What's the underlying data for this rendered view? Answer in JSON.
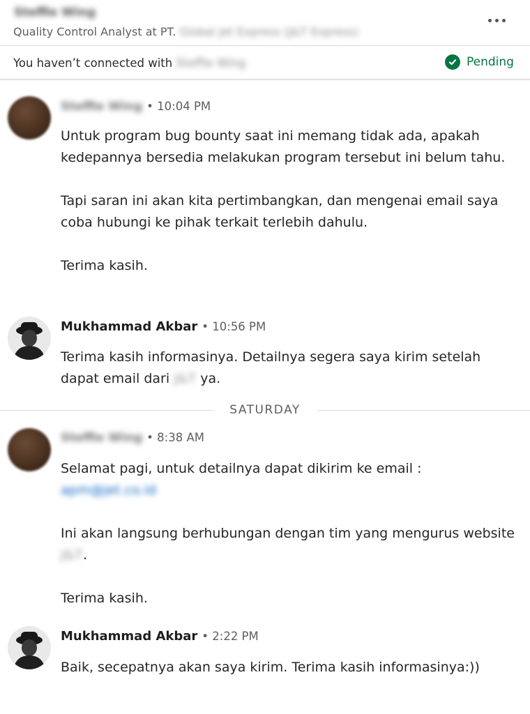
{
  "header": {
    "contact_name": "Steffie Wing",
    "headline_prefix": "Quality Control Analyst",
    "headline_at": "at PT.",
    "company": "Global Jet Express (J&T Express)",
    "more_icon": "ellipsis-icon"
  },
  "connection": {
    "text_prefix": "You haven’t connected with",
    "name": "Steffie Wing",
    "status": "Pending",
    "status_icon": "check-circle-icon",
    "status_color": "#057642"
  },
  "day_divider": "SATURDAY",
  "messages": [
    {
      "sender": "Steffie Wing",
      "time": "• 10:04 PM",
      "paragraphs": [
        "Untuk program bug bounty saat ini memang tidak ada, apakah kedepannya bersedia melakukan program tersebut ini belum tahu.",
        "Tapi saran ini akan kita pertimbangkan, dan mengenai email saya coba hubungi ke pihak terkait terlebih dahulu.",
        "Terima kasih."
      ]
    },
    {
      "sender": "Mukhammad Akbar",
      "time": "• 10:56 PM",
      "text_part1": "Terima kasih informasinya. Detailnya segera saya kirim setelah dapat email dari",
      "blurred": "J&T",
      "text_part2": "ya."
    },
    {
      "sender": "Steffie Wing",
      "time": "• 8:38 AM",
      "line1": "Selamat pagi, untuk detailnya dapat dikirim ke email :",
      "email": "apm@jet.co.id",
      "line2_part1": "Ini akan langsung berhubungan dengan tim yang mengurus website",
      "blurred": "J&T",
      "line2_part2": ".",
      "closing": "Terima kasih."
    },
    {
      "sender": "Mukhammad Akbar",
      "time": "• 2:22 PM",
      "text": "Baik, secepatnya akan saya kirim. Terima kasih informasinya:))"
    }
  ]
}
